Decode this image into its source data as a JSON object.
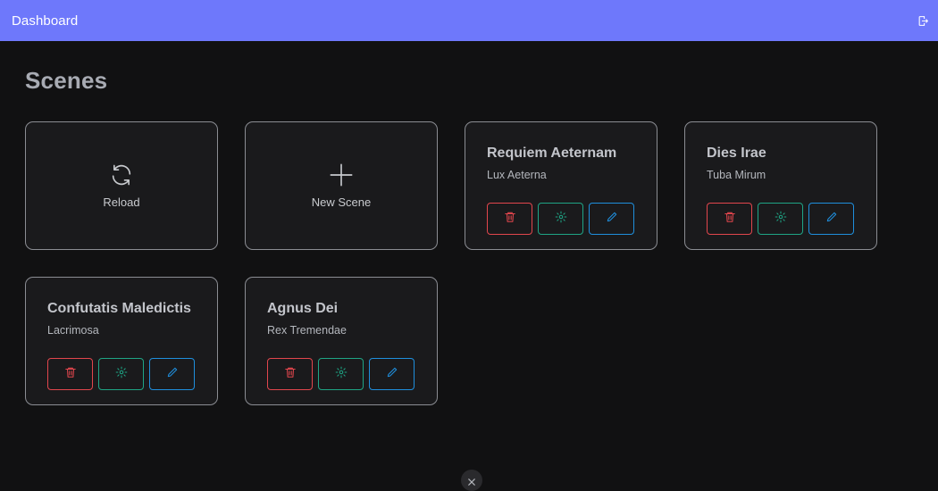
{
  "header": {
    "title": "Dashboard",
    "logout_icon": "logout-icon"
  },
  "page": {
    "title": "Scenes"
  },
  "actions": {
    "reload_label": "Reload",
    "reload_icon": "refresh-icon",
    "new_scene_label": "New Scene",
    "new_scene_icon": "plus-icon"
  },
  "scenes": [
    {
      "name": "Requiem Aeternam",
      "subtitle": "Lux Aeterna"
    },
    {
      "name": "Dies Irae",
      "subtitle": "Tuba Mirum"
    },
    {
      "name": "Confutatis Maledictis",
      "subtitle": "Lacrimosa"
    },
    {
      "name": "Agnus Dei",
      "subtitle": "Rex Tremendae"
    }
  ],
  "scene_buttons": {
    "delete_icon": "trash-icon",
    "settings_icon": "gear-icon",
    "edit_icon": "pencil-icon"
  },
  "colors": {
    "header_bg": "#6e78fb",
    "page_bg": "#111112",
    "delete": "#e2464d",
    "settings": "#1fa585",
    "edit": "#1f8fdd"
  },
  "bottom_handle": {
    "icon": "close-x-icon",
    "label": "X"
  }
}
